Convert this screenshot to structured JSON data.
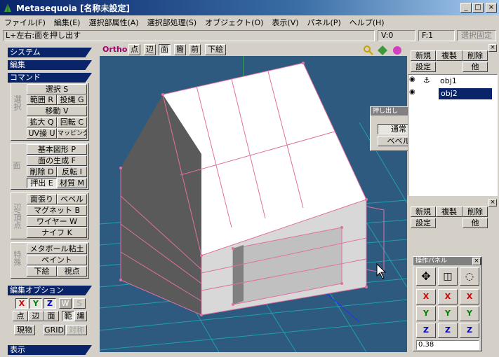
{
  "window": {
    "title": "Metasequoia [名称未設定]",
    "min": "_",
    "max": "□",
    "close": "×"
  },
  "menu": [
    "ファイル(F)",
    "編集(E)",
    "選択部属性(A)",
    "選択部処理(S)",
    "オブジェクト(O)",
    "表示(V)",
    "パネル(P)",
    "ヘルプ(H)"
  ],
  "status": {
    "hint": "L+左右:面を押し出す",
    "v": "V:0",
    "f": "F:1",
    "lock": "選択固定"
  },
  "sidebar": {
    "system": "システム",
    "edit": "編集",
    "command": "コマンド",
    "group1_label": "選択",
    "group2_label": "面",
    "group3_label": "辺/頂点",
    "group4_label": "特殊",
    "select": "選択 S",
    "range": "範囲 R",
    "lasso": "投縄 G",
    "move": "移動 V",
    "scale": "拡大 Q",
    "rotate": "回転 C",
    "uvpaint": "UV操 U",
    "mapping": "マッピング",
    "primitive": "基本図形 P",
    "face_gen": "面の生成 F",
    "delete": "削除 D",
    "flip": "反転 I",
    "extrude": "押出 E",
    "material": "材質 M",
    "stretch": "面張り",
    "bevel": "ベベル",
    "magnet": "マグネット B",
    "wire": "ワイヤー W",
    "knife": "ナイフ K",
    "metaball": "メタボール粘土",
    "paint": "ペイント",
    "sketch": "下絵",
    "viewpoint": "視点",
    "edit_options": "編集オプション",
    "x": "X",
    "y": "Y",
    "z": "Z",
    "w": "W",
    "s": "S",
    "point": "点",
    "edge": "辺",
    "face": "面",
    "range_opt": "範",
    "lasso_opt": "縄",
    "current": "現物",
    "grid": "GRID",
    "symmetry": "対称",
    "display": "表示"
  },
  "viewbar": {
    "ortho": "Ortho",
    "point": "点",
    "edge": "辺",
    "face": "面",
    "simple": "簡",
    "front": "前",
    "sketch": "下絵"
  },
  "objpanel": {
    "new": "新規",
    "copy": "複製",
    "delete": "削除",
    "settings": "設定",
    "other": "他",
    "obj1": "obj1",
    "obj2": "obj2"
  },
  "matpanel": {
    "new": "新規",
    "copy": "複製",
    "delete": "削除",
    "settings": "設定",
    "other": "他"
  },
  "extrude_dialog": {
    "title": "押し出し",
    "normal": "通常",
    "bevel": "ベベル"
  },
  "oppanel": {
    "title": "操作パネル",
    "x": "X",
    "y": "Y",
    "z": "Z",
    "value": "0.38"
  },
  "colors": {
    "accent": "#0a246a",
    "viewport": "#2d5a7e",
    "grid": "#1fa0b0",
    "edge": "#e070a0"
  }
}
